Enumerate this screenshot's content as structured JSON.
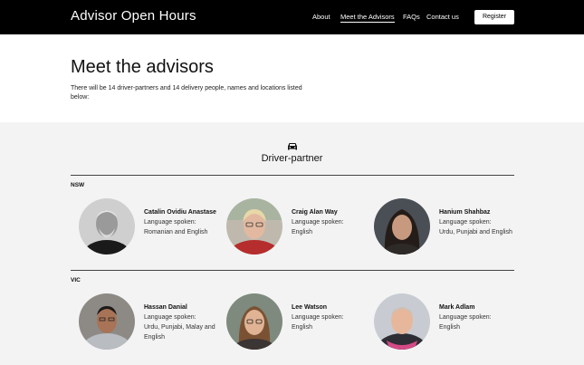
{
  "header": {
    "brand": "Advisor Open Hours",
    "nav": [
      {
        "label": "About"
      },
      {
        "label": "Meet the Advisors"
      },
      {
        "label": "FAQs"
      },
      {
        "label": "Contact us"
      }
    ],
    "register_label": "Register"
  },
  "hero": {
    "title": "Meet the advisors",
    "description": "There will be 14 driver-partners and 14 delivery people, names and locations listed below:"
  },
  "section": {
    "icon": "car-icon",
    "title": "Driver-partner",
    "regions": [
      {
        "label": "NSW",
        "advisors": [
          {
            "name": "Catalin Ovidiu Anastase",
            "lang_label": "Language spoken:",
            "languages": "Romanian and English"
          },
          {
            "name": "Craig Alan Way",
            "lang_label": "Language spoken:",
            "languages": "English"
          },
          {
            "name": "Hanium Shahbaz",
            "lang_label": "Language spoken:",
            "languages": "Urdu, Punjabi and English"
          }
        ]
      },
      {
        "label": "VIC",
        "advisors": [
          {
            "name": "Hassan Danial",
            "lang_label": "Language spoken:",
            "languages": "Urdu, Punjabi, Malay and English"
          },
          {
            "name": "Lee Watson",
            "lang_label": "Language spoken:",
            "languages": "English"
          },
          {
            "name": "Mark Adlam",
            "lang_label": "Language spoken:",
            "languages": "English"
          }
        ]
      }
    ]
  }
}
